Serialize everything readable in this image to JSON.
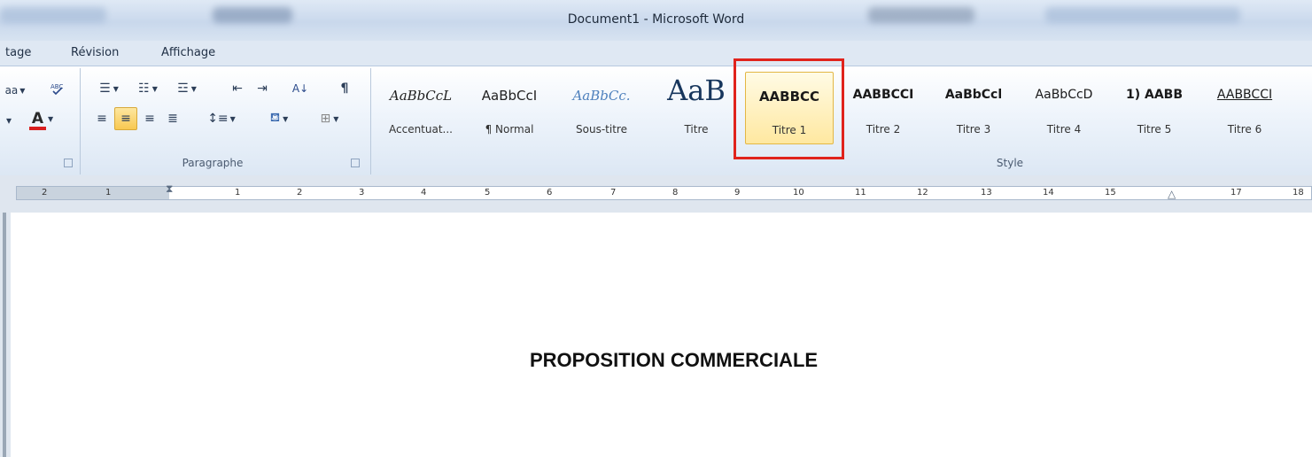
{
  "window": {
    "title": "Document1 - Microsoft Word"
  },
  "tabs": [
    {
      "label": "tage"
    },
    {
      "label": "Révision"
    },
    {
      "label": "Affichage"
    }
  ],
  "ribbon": {
    "font_group": {
      "partial_label": "aa",
      "font_color_glyph": "A",
      "font_color": "#d81e1e"
    },
    "paragraph_group": {
      "label": "Paragraphe",
      "pilcrow": "¶",
      "sort_glyph": "A↓"
    },
    "styles_group": {
      "label": "Style",
      "items": [
        {
          "preview": "AaBbCcL",
          "name": "Accentuat..."
        },
        {
          "preview": "AaBbCcI",
          "name": "¶ Normal"
        },
        {
          "preview": "AaBbCc.",
          "name": "Sous-titre"
        },
        {
          "preview": "AaB",
          "name": "Titre"
        },
        {
          "preview": "AABBCC",
          "name": "Titre 1",
          "selected": true
        },
        {
          "preview": "AABBCCI",
          "name": "Titre 2"
        },
        {
          "preview": "AaBbCcl",
          "name": "Titre 3"
        },
        {
          "preview": "AaBbCcD",
          "name": "Titre 4"
        },
        {
          "preview": "1) AABB",
          "name": "Titre 5"
        },
        {
          "preview": "AABBCCI",
          "name": "Titre 6"
        }
      ]
    }
  },
  "ruler": {
    "numbers": [
      "2",
      "1",
      "1",
      "2",
      "3",
      "4",
      "5",
      "6",
      "7",
      "8",
      "9",
      "10",
      "11",
      "12",
      "13",
      "14",
      "15",
      "17",
      "18"
    ]
  },
  "document": {
    "heading": "PROPOSITION COMMERCIALE"
  },
  "colors": {
    "highlight_box": "#e0231c",
    "ribbon": "#dce7f4",
    "selected_style": "#ffe8a0"
  }
}
